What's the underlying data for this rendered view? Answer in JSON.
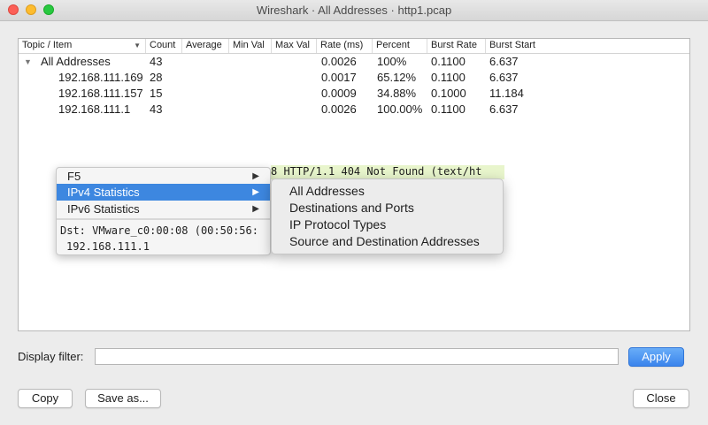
{
  "window": {
    "title": "Wireshark · All Addresses · http1.pcap"
  },
  "tree": {
    "columns": [
      "Topic / Item",
      "Count",
      "Average",
      "Min Val",
      "Max Val",
      "Rate (ms)",
      "Percent",
      "Burst Rate",
      "Burst Start"
    ],
    "rows": [
      {
        "item": "All Addresses",
        "count": "43",
        "average": "",
        "min": "",
        "max": "",
        "rate": "0.0026",
        "percent": "100%",
        "burst_rate": "0.1100",
        "burst_start": "6.637"
      },
      {
        "item": "192.168.111.169",
        "count": "28",
        "average": "",
        "min": "",
        "max": "",
        "rate": "0.0017",
        "percent": "65.12%",
        "burst_rate": "0.1100",
        "burst_start": "6.637"
      },
      {
        "item": "192.168.111.157",
        "count": "15",
        "average": "",
        "min": "",
        "max": "",
        "rate": "0.0009",
        "percent": "34.88%",
        "burst_rate": "0.1000",
        "burst_start": "11.184"
      },
      {
        "item": "192.168.111.1",
        "count": "43",
        "average": "",
        "min": "",
        "max": "",
        "rate": "0.0026",
        "percent": "100.00%",
        "burst_rate": "0.1100",
        "burst_start": "6.637"
      }
    ]
  },
  "context_menu": {
    "items": [
      {
        "label": "F5",
        "has_submenu": true
      },
      {
        "label": "IPv4 Statistics",
        "has_submenu": true,
        "selected": true
      },
      {
        "label": "IPv6 Statistics",
        "has_submenu": true
      }
    ],
    "detail_lines": [
      "Dst: VMware_c0:00:08 (00:50:56:",
      "192.168.111.1"
    ]
  },
  "background_packet": {
    "text": "8 HTTP/1.1 404 Not Found  (text/ht"
  },
  "submenu": {
    "items": [
      "All Addresses",
      "Destinations and Ports",
      "IP Protocol Types",
      "Source and Destination Addresses"
    ]
  },
  "filter": {
    "label": "Display filter:",
    "value": "",
    "apply_label": "Apply"
  },
  "buttons": {
    "copy": "Copy",
    "save_as": "Save as...",
    "close": "Close"
  },
  "colors": {
    "accent": "#3d87e0",
    "packet_bg": "#e8f5cc"
  },
  "icons": {
    "expand": "disclosure-down-icon",
    "submenu": "submenu-arrow-icon",
    "sort": "chevron-down-icon"
  }
}
